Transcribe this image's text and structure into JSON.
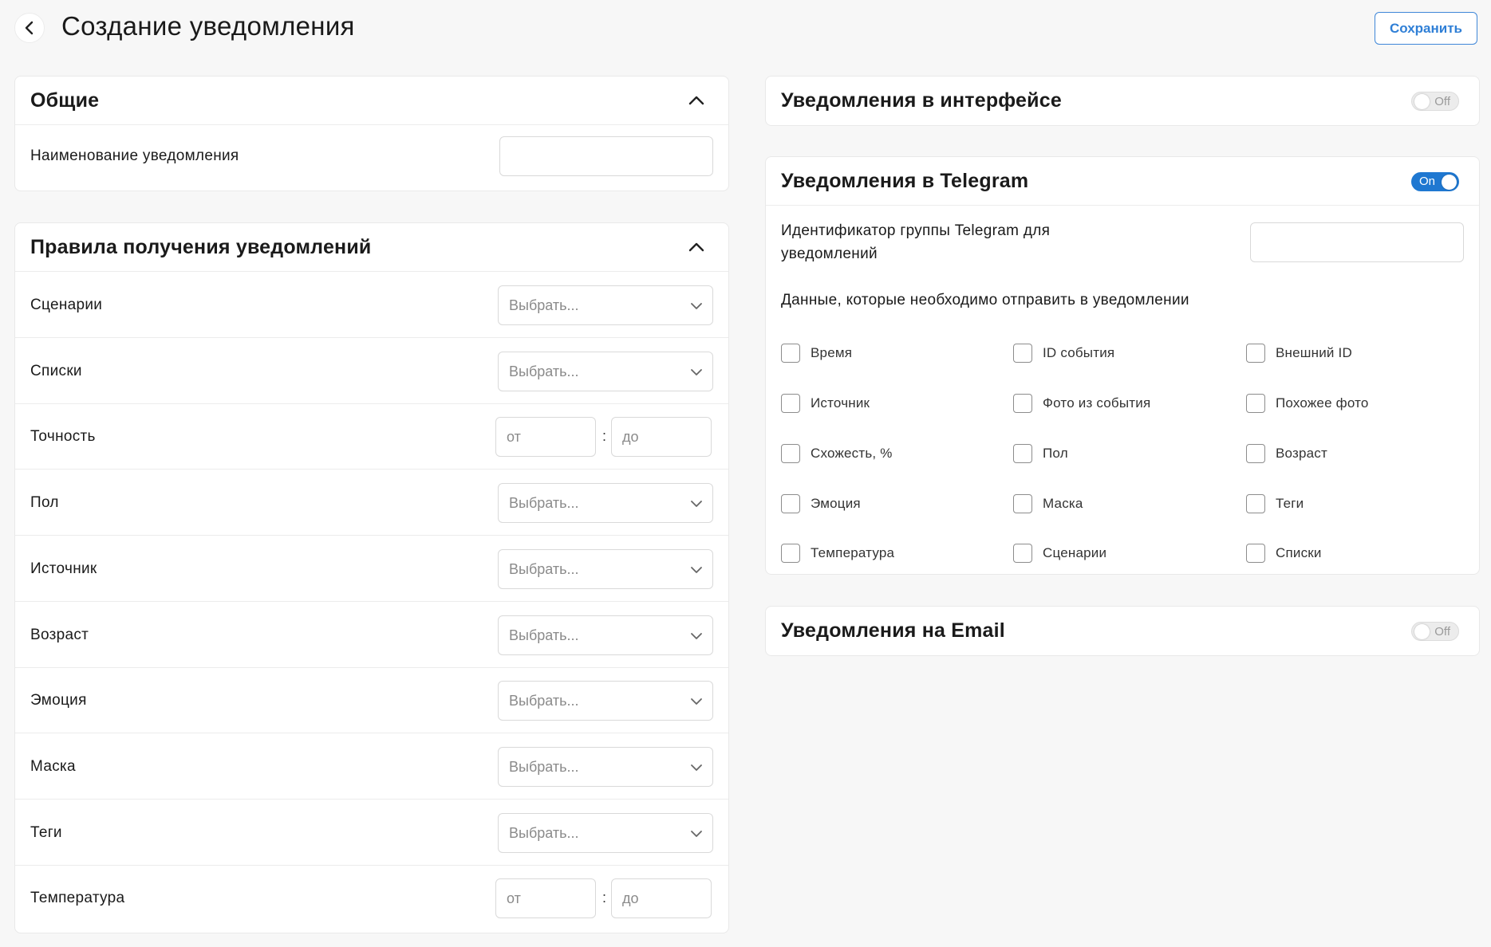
{
  "header": {
    "title": "Создание уведомления",
    "save_label": "Сохранить"
  },
  "general": {
    "title": "Общие",
    "name_label": "Наименование уведомления",
    "name_value": ""
  },
  "rules": {
    "title": "Правила получения уведомлений",
    "select_placeholder": "Выбрать...",
    "from_placeholder": "от",
    "to_placeholder": "до",
    "range_separator": ":",
    "rows": [
      {
        "label": "Сценарии",
        "type": "select"
      },
      {
        "label": "Списки",
        "type": "select"
      },
      {
        "label": "Точность",
        "type": "range"
      },
      {
        "label": "Пол",
        "type": "select"
      },
      {
        "label": "Источник",
        "type": "select"
      },
      {
        "label": "Возраст",
        "type": "select"
      },
      {
        "label": "Эмоция",
        "type": "select"
      },
      {
        "label": "Маска",
        "type": "select"
      },
      {
        "label": "Теги",
        "type": "select"
      },
      {
        "label": "Температура",
        "type": "range"
      }
    ]
  },
  "interface_notifications": {
    "title": "Уведомления в интерфейсе",
    "toggle": "Off"
  },
  "telegram": {
    "title": "Уведомления в Telegram",
    "toggle": "On",
    "group_id_label_line1": "Идентификатор группы Telegram для",
    "group_id_label_line2": "уведомлений",
    "group_id_value": "",
    "data_heading": "Данные, которые необходимо отправить в уведомлении",
    "fields": [
      "Время",
      "ID события",
      "Внешний ID",
      "Источник",
      "Фото из события",
      "Похожее фото",
      "Схожесть, %",
      "Пол",
      "Возраст",
      "Эмоция",
      "Маска",
      "Теги",
      "Температура",
      "Сценарии",
      "Списки"
    ]
  },
  "email": {
    "title": "Уведомления на Email",
    "toggle": "Off"
  },
  "colors": {
    "accent": "#1f78d1",
    "save_border": "#3f87d8",
    "background": "#f7f7f7",
    "card": "#ffffff",
    "border": "#e9e9e9"
  },
  "icons": {
    "back": "chevron-left-icon",
    "collapse": "chevron-up-icon",
    "dropdown": "chevron-down-icon"
  }
}
